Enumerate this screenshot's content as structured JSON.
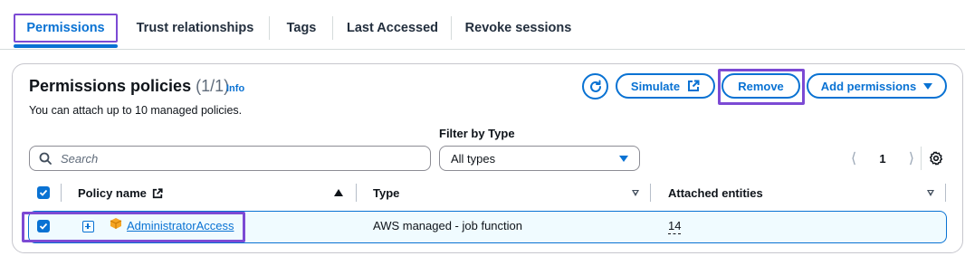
{
  "tabs": [
    {
      "label": "Permissions",
      "selected": true
    },
    {
      "label": "Trust relationships"
    },
    {
      "label": "Tags"
    },
    {
      "label": "Last Accessed"
    },
    {
      "label": "Revoke sessions"
    }
  ],
  "policies": {
    "title": "Permissions policies",
    "count": "(1/1)",
    "info_label": "Info",
    "description": "You can attach up to 10 managed policies.",
    "buttons": {
      "refresh_icon": "refresh-icon",
      "simulate": "Simulate",
      "remove": "Remove",
      "add_permissions": "Add permissions"
    },
    "filter": {
      "label": "Filter by Type",
      "search_placeholder": "Search",
      "type_selected": "All types"
    },
    "pagination": {
      "current_page": "1"
    },
    "table": {
      "columns": [
        "Policy name",
        "Type",
        "Attached entities"
      ],
      "rows": [
        {
          "selected": true,
          "name": "AdministratorAccess",
          "type": "AWS managed - job function",
          "attached_entities": "14"
        }
      ]
    }
  },
  "colors": {
    "accent": "#0972d3",
    "highlight_outline": "#7c4ad4",
    "row_selected_bg": "#f0fbff"
  }
}
